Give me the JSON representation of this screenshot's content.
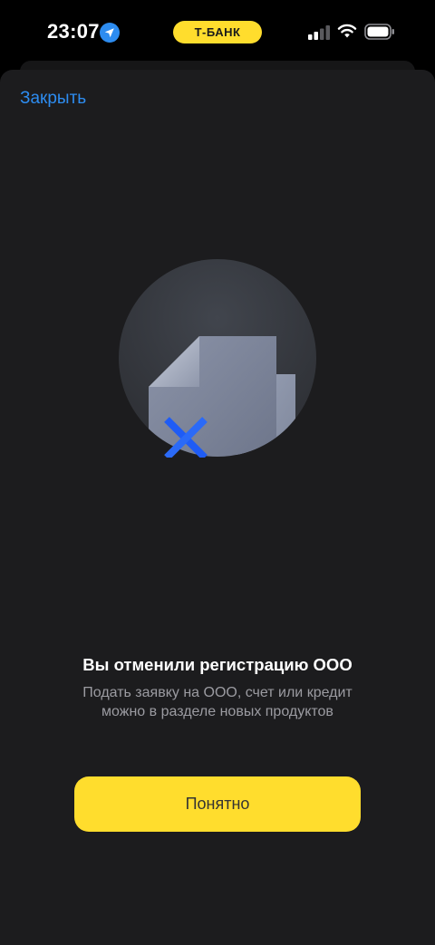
{
  "status_bar": {
    "time": "23:07",
    "carrier": "Т-БАНК",
    "icons": [
      "location-arrow-icon",
      "cellular-signal-icon",
      "wifi-icon",
      "battery-icon"
    ]
  },
  "sheet": {
    "close_label": "Закрыть"
  },
  "illustration": {
    "icons": [
      "document-icon",
      "cross-icon"
    ]
  },
  "message": {
    "title": "Вы отменили регистрацию ООО",
    "subtitle": "Подать заявку на ООО, счет или кредит можно в разделе новых продуктов"
  },
  "actions": {
    "ok_label": "Понятно"
  },
  "colors": {
    "accent_yellow": "#ffdd2d",
    "link_blue": "#2d8cf0",
    "sheet_background": "#1c1c1e",
    "cross_blue": "#1f5cf5"
  }
}
